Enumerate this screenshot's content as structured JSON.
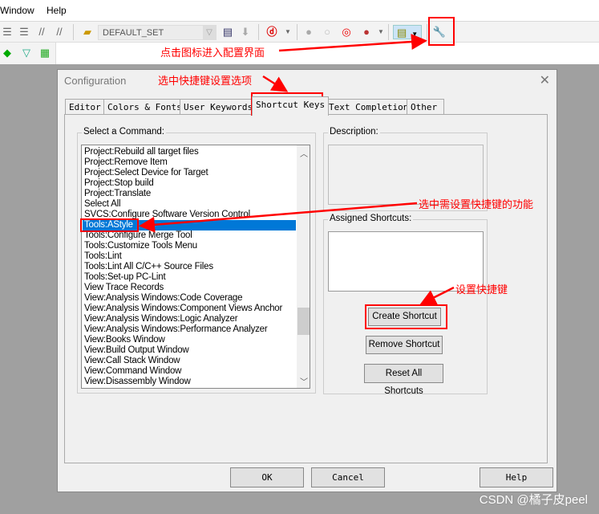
{
  "menubar": {
    "items": [
      "Window",
      "Help"
    ]
  },
  "toolbar": {
    "config_set": "DEFAULT_SET",
    "icons": [
      "indent-icon",
      "outdent-icon",
      "comment-icon",
      "uncomment-icon",
      "open-folder-icon",
      "manage-icon",
      "pack-icon",
      "debug-icon",
      "breakpoint-icon",
      "breakpoint-disabled-icon",
      "kill-breakpoints-icon",
      "clear-icon",
      "window-icon",
      "wrench-icon"
    ]
  },
  "dialog": {
    "title": "Configuration",
    "tabs": [
      "Editor",
      "Colors & Fonts",
      "User Keywords",
      "Shortcut Keys",
      "Text Completion",
      "Other"
    ],
    "active_tab": "Shortcut Keys",
    "select_command_label": "Select a Command:",
    "commands": [
      "Project:Rebuild all target files",
      "Project:Remove Item",
      "Project:Select Device for Target",
      "Project:Stop build",
      "Project:Translate",
      "Select All",
      "SVCS:Configure Software Version Control",
      "Tools:AStyle",
      "Tools:Configure Merge Tool",
      "Tools:Customize Tools Menu",
      "Tools:Lint",
      "Tools:Lint All C/C++ Source Files",
      "Tools:Set-up PC-Lint",
      "View Trace Records",
      "View:Analysis Windows:Code Coverage",
      "View:Analysis Windows:Component Views Anchor",
      "View:Analysis Windows:Logic Analyzer",
      "View:Analysis Windows:Performance Analyzer",
      "View:Books Window",
      "View:Build Output Window",
      "View:Call Stack Window",
      "View:Command Window",
      "View:Disassembly Window"
    ],
    "selected_command": "Tools:AStyle",
    "description_label": "Description:",
    "assigned_label": "Assigned Shortcuts:",
    "create_shortcut": "Create Shortcut",
    "remove_shortcut": "Remove Shortcut",
    "reset_shortcuts": "Reset All Shortcuts",
    "ok": "OK",
    "cancel": "Cancel",
    "help": "Help"
  },
  "annotations": {
    "click_icon": "点击图标进入配置界面",
    "select_tab": "选中快捷键设置选项",
    "select_function": "选中需设置快捷键的功能",
    "set_shortcut": "设置快捷键",
    "color": "#ff0000"
  },
  "watermark": "CSDN @橘子皮peel"
}
